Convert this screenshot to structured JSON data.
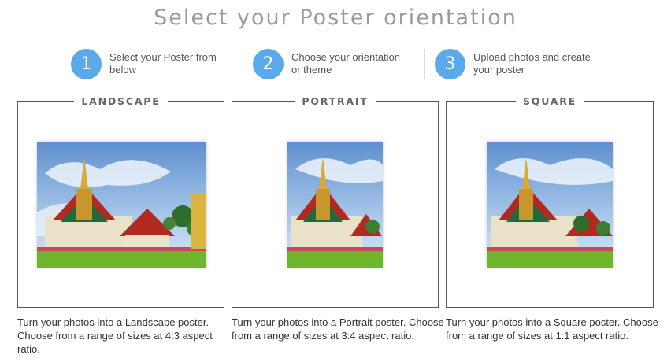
{
  "header": {
    "title": "Select your Poster orientation"
  },
  "steps": [
    {
      "number": "1",
      "text": "Select your Poster from below"
    },
    {
      "number": "2",
      "text": "Choose your orientation or theme"
    },
    {
      "number": "3",
      "text": "Upload photos and create your poster"
    }
  ],
  "options": [
    {
      "title": "LANDSCAPE",
      "description": "Turn your photos into a Landscape poster. Choose from a range of sizes at 4:3 aspect ratio.",
      "aspect_ratio": "4:3"
    },
    {
      "title": "PORTRAIT",
      "description": "Turn your photos into a Portrait poster. Choose from a range of sizes at 3:4 aspect ratio.",
      "aspect_ratio": "3:4"
    },
    {
      "title": "SQUARE",
      "description": "Turn your photos into a Square poster. Choose from a range of sizes at 1:1 aspect ratio.",
      "aspect_ratio": "1:1"
    }
  ],
  "colors": {
    "step_circle": "#5aa9ea",
    "title_text": "#9a9a9a",
    "card_border": "#555555"
  }
}
